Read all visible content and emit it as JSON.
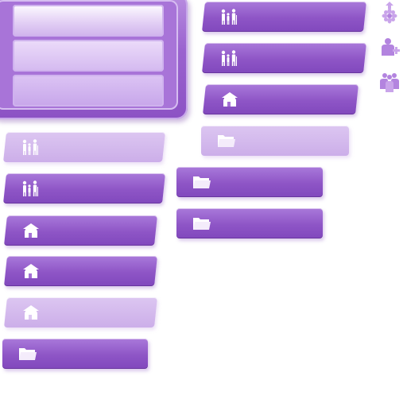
{
  "colors": {
    "accent": "#8e55c6",
    "accent_light": "#d4b9f0",
    "icon": "#ffffff"
  },
  "panel": {
    "rows": [
      "",
      "",
      ""
    ]
  },
  "tabs": [
    {
      "name": "tab-family-top-1",
      "icon": "family-icon",
      "state": "normal"
    },
    {
      "name": "tab-family-top-2",
      "icon": "family-icon",
      "state": "normal"
    },
    {
      "name": "tab-home-top",
      "icon": "home-icon",
      "state": "normal"
    },
    {
      "name": "tab-folder-top-faded",
      "icon": "folder-icon",
      "state": "disabled"
    },
    {
      "name": "tab-folder-mid-1",
      "icon": "folder-icon",
      "state": "normal"
    },
    {
      "name": "tab-folder-mid-2",
      "icon": "folder-icon",
      "state": "normal"
    },
    {
      "name": "tab-family-left-faded",
      "icon": "family-icon",
      "state": "disabled"
    },
    {
      "name": "tab-family-left",
      "icon": "family-icon",
      "state": "normal"
    },
    {
      "name": "tab-home-left-1",
      "icon": "home-icon",
      "state": "normal"
    },
    {
      "name": "tab-home-left-2",
      "icon": "home-icon",
      "state": "normal"
    },
    {
      "name": "tab-home-left-faded",
      "icon": "home-icon",
      "state": "disabled"
    },
    {
      "name": "tab-folder-left",
      "icon": "folder-icon",
      "state": "normal"
    }
  ],
  "side_icons": [
    "upload-flower-icon",
    "add-user-icon",
    "group-icon"
  ]
}
